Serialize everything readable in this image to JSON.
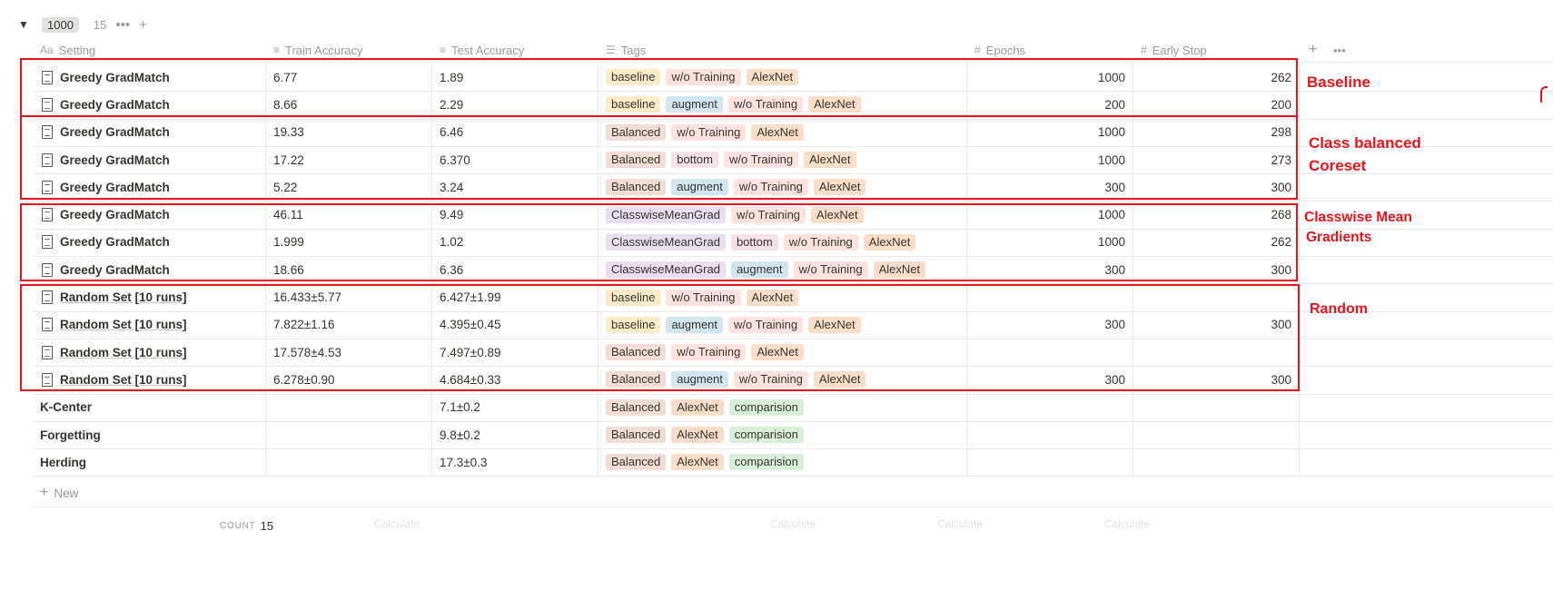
{
  "group": {
    "name": "1000",
    "count": "15",
    "more": "•••",
    "add": "+"
  },
  "columns": {
    "setting": "Setting",
    "train": "Train Accuracy",
    "test": "Test Accuracy",
    "tags": "Tags",
    "epochs": "Epochs",
    "early": "Early Stop",
    "add": "+",
    "more": "•••"
  },
  "rows": [
    {
      "setting": "Greedy GradMatch",
      "train": "6.77",
      "test": "1.89",
      "tags": [
        "baseline",
        "w/o Training",
        "AlexNet"
      ],
      "epochs": "1000",
      "early": "262"
    },
    {
      "setting": "Greedy GradMatch",
      "train": "8.66",
      "test": "2.29",
      "tags": [
        "baseline",
        "augment",
        "w/o Training",
        "AlexNet"
      ],
      "epochs": "200",
      "early": "200"
    },
    {
      "setting": "Greedy GradMatch",
      "train": "19.33",
      "test": "6.46",
      "tags": [
        "Balanced",
        "w/o Training",
        "AlexNet"
      ],
      "epochs": "1000",
      "early": "298"
    },
    {
      "setting": "Greedy GradMatch",
      "train": "17.22",
      "test": "6.370",
      "tags": [
        "Balanced",
        "bottom",
        "w/o Training",
        "AlexNet"
      ],
      "epochs": "1000",
      "early": "273"
    },
    {
      "setting": "Greedy GradMatch",
      "train": "5.22",
      "test": "3.24",
      "tags": [
        "Balanced",
        "augment",
        "w/o Training",
        "AlexNet"
      ],
      "epochs": "300",
      "early": "300"
    },
    {
      "setting": "Greedy GradMatch",
      "train": "46.11",
      "test": "9.49",
      "tags": [
        "ClasswiseMeanGrad",
        "w/o Training",
        "AlexNet"
      ],
      "epochs": "1000",
      "early": "268"
    },
    {
      "setting": "Greedy GradMatch",
      "train": "1.999",
      "test": "1.02",
      "tags": [
        "ClasswiseMeanGrad",
        "bottom",
        "w/o Training",
        "AlexNet"
      ],
      "epochs": "1000",
      "early": "262"
    },
    {
      "setting": "Greedy GradMatch",
      "train": "18.66",
      "test": "6.36",
      "tags": [
        "ClasswiseMeanGrad",
        "augment",
        "w/o Training",
        "AlexNet"
      ],
      "epochs": "300",
      "early": "300"
    },
    {
      "setting": "Random Set [10 runs]",
      "train": "16.433±5.77",
      "test": "6.427±1.99",
      "tags": [
        "baseline",
        "w/o Training",
        "AlexNet"
      ],
      "epochs": "",
      "early": ""
    },
    {
      "setting": "Random Set [10 runs]",
      "train": "7.822±1.16",
      "test": "4.395±0.45",
      "tags": [
        "baseline",
        "augment",
        "w/o Training",
        "AlexNet"
      ],
      "epochs": "300",
      "early": "300"
    },
    {
      "setting": "Random Set [10 runs]",
      "train": "17.578±4.53",
      "test": "7.497±0.89",
      "tags": [
        "Balanced",
        "w/o Training",
        "AlexNet"
      ],
      "epochs": "",
      "early": ""
    },
    {
      "setting": "Random Set [10 runs]",
      "train": "6.278±0.90",
      "test": "4.684±0.33",
      "tags": [
        "Balanced",
        "augment",
        "w/o Training",
        "AlexNet"
      ],
      "epochs": "300",
      "early": "300"
    },
    {
      "setting": "K-Center",
      "train": "",
      "test": "7.1±0.2",
      "tags": [
        "Balanced",
        "AlexNet",
        "comparision"
      ],
      "epochs": "",
      "early": ""
    },
    {
      "setting": "Forgetting",
      "train": "",
      "test": "9.8±0.2",
      "tags": [
        "Balanced",
        "AlexNet",
        "comparision"
      ],
      "epochs": "",
      "early": ""
    },
    {
      "setting": "Herding",
      "train": "",
      "test": "17.3±0.3",
      "tags": [
        "Balanced",
        "AlexNet",
        "comparision"
      ],
      "epochs": "",
      "early": ""
    }
  ],
  "new_label": "New",
  "footer": {
    "count_label": "COUNT",
    "count_value": "15",
    "calculate": "Calculate"
  },
  "annotations": {
    "baseline": "Baseline",
    "class_balanced_1": "Class balanced",
    "class_balanced_2": "Coreset",
    "classwise_1": "Classwise Mean",
    "classwise_2": "Gradients",
    "random": "Random"
  },
  "colors": {
    "annotation_red": "#e8141c",
    "row_border": "#e9e9e7",
    "muted_text": "#9b9a97"
  }
}
